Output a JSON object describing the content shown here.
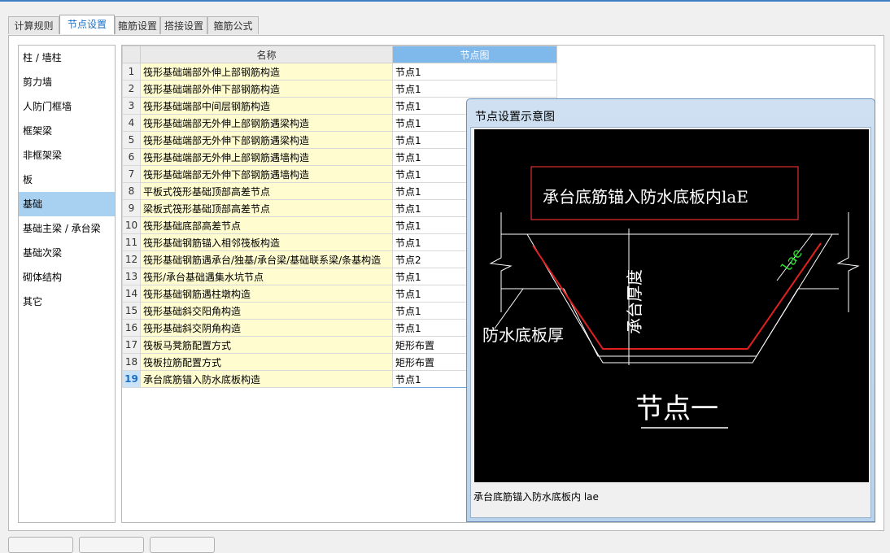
{
  "tabs": [
    {
      "label": "计算规则",
      "active": false
    },
    {
      "label": "节点设置",
      "active": true
    },
    {
      "label": "箍筋设置",
      "active": false
    },
    {
      "label": "搭接设置",
      "active": false
    },
    {
      "label": "箍筋公式",
      "active": false
    }
  ],
  "sidebar": {
    "items": [
      {
        "label": "柱 / 墙柱",
        "active": false
      },
      {
        "label": "剪力墙",
        "active": false
      },
      {
        "label": "人防门框墙",
        "active": false
      },
      {
        "label": "框架梁",
        "active": false
      },
      {
        "label": "非框架梁",
        "active": false
      },
      {
        "label": "板",
        "active": false
      },
      {
        "label": "基础",
        "active": true
      },
      {
        "label": "基础主梁 / 承台梁",
        "active": false
      },
      {
        "label": "基础次梁",
        "active": false
      },
      {
        "label": "砌体结构",
        "active": false
      },
      {
        "label": "其它",
        "active": false
      }
    ]
  },
  "grid": {
    "columns": {
      "name": "名称",
      "diagram": "节点图"
    },
    "selected_row": 19,
    "rows": [
      {
        "no": "1",
        "name": "筏形基础端部外伸上部钢筋构造",
        "node": "节点1"
      },
      {
        "no": "2",
        "name": "筏形基础端部外伸下部钢筋构造",
        "node": "节点1"
      },
      {
        "no": "3",
        "name": "筏形基础端部中间层钢筋构造",
        "node": "节点1"
      },
      {
        "no": "4",
        "name": "筏形基础端部无外伸上部钢筋遇梁构造",
        "node": "节点1"
      },
      {
        "no": "5",
        "name": "筏形基础端部无外伸下部钢筋遇梁构造",
        "node": "节点1"
      },
      {
        "no": "6",
        "name": "筏形基础端部无外伸上部钢筋遇墙构造",
        "node": "节点1"
      },
      {
        "no": "7",
        "name": "筏形基础端部无外伸下部钢筋遇墙构造",
        "node": "节点1"
      },
      {
        "no": "8",
        "name": "平板式筏形基础顶部高差节点",
        "node": "节点1"
      },
      {
        "no": "9",
        "name": "梁板式筏形基础顶部高差节点",
        "node": "节点1"
      },
      {
        "no": "10",
        "name": "筏形基础底部高差节点",
        "node": "节点1"
      },
      {
        "no": "11",
        "name": "筏形基础钢筋锚入相邻筏板构造",
        "node": "节点1"
      },
      {
        "no": "12",
        "name": "筏形基础钢筋遇承台/独基/承台梁/基础联系梁/条基构造",
        "node": "节点2"
      },
      {
        "no": "13",
        "name": "筏形/承台基础遇集水坑节点",
        "node": "节点1"
      },
      {
        "no": "14",
        "name": "筏形基础钢筋遇柱墩构造",
        "node": "节点1"
      },
      {
        "no": "15",
        "name": "筏形基础斜交阳角构造",
        "node": "节点1"
      },
      {
        "no": "16",
        "name": "筏形基础斜交阴角构造",
        "node": "节点1"
      },
      {
        "no": "17",
        "name": "筏板马凳筋配置方式",
        "node": "矩形布置"
      },
      {
        "no": "18",
        "name": "筏板拉筋配置方式",
        "node": "矩形布置"
      },
      {
        "no": "19",
        "name": "承台底筋锚入防水底板构造",
        "node": "节点1"
      }
    ]
  },
  "popup": {
    "title": "节点设置示意图",
    "caption": "承台底筋锚入防水底板内 lae",
    "diagram": {
      "box_text": "承台底筋锚入防水底板内laE",
      "thickness_label": "承台厚度",
      "slab_label": "防水底板厚",
      "lae_label": "lae",
      "node_title": "节点一",
      "colors": {
        "box": "#e03030",
        "rebar": "#e02020",
        "lae": "#30e030",
        "lines": "#ffffff"
      }
    }
  }
}
